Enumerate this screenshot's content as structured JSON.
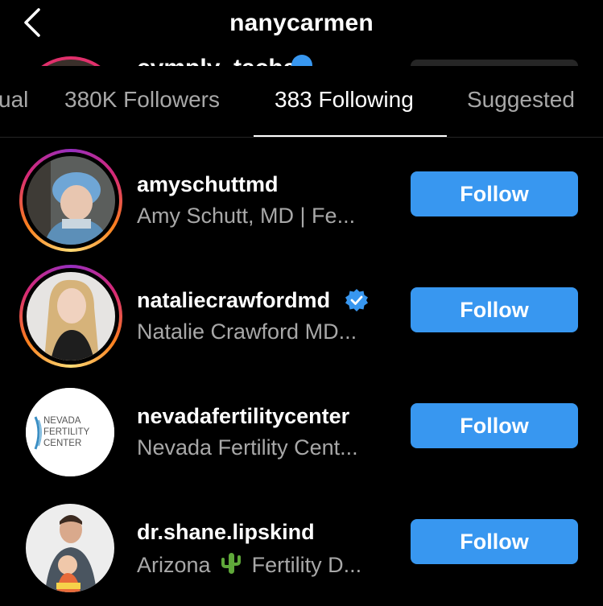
{
  "header": {
    "title": "nanycarmen",
    "back_icon": "chevron-left-icon"
  },
  "peek": {
    "username": "cymply_tacha"
  },
  "tabs": [
    {
      "label": "ual"
    },
    {
      "label": "380K Followers"
    },
    {
      "label": "383 Following",
      "active": true
    },
    {
      "label": "Suggested"
    }
  ],
  "list": [
    {
      "username": "amyschuttmd",
      "fullname": "Amy Schutt, MD | Fe...",
      "verified": false,
      "button": "Follow",
      "avatar": "photo-surgeon-blue-cap"
    },
    {
      "username": "nataliecrawfordmd",
      "fullname": "Natalie Crawford MD...",
      "verified": true,
      "button": "Follow",
      "avatar": "photo-blonde-woman"
    },
    {
      "username": "nevadafertilitycenter",
      "fullname": "Nevada Fertility Cent...",
      "verified": false,
      "button": "Follow",
      "logo_lines": [
        "NEVADA",
        "FERTILITY",
        "CENTER"
      ]
    },
    {
      "username": "dr.shane.lipskind",
      "fullname_prefix": "Arizona",
      "fullname_suffix": "Fertility D...",
      "emoji": "cactus-icon",
      "verified": false,
      "button": "Follow",
      "avatar": "photo-man-with-baby"
    }
  ],
  "colors": {
    "accent": "#3897f0",
    "background": "#000000",
    "secondary_text": "#a8a8a8"
  }
}
